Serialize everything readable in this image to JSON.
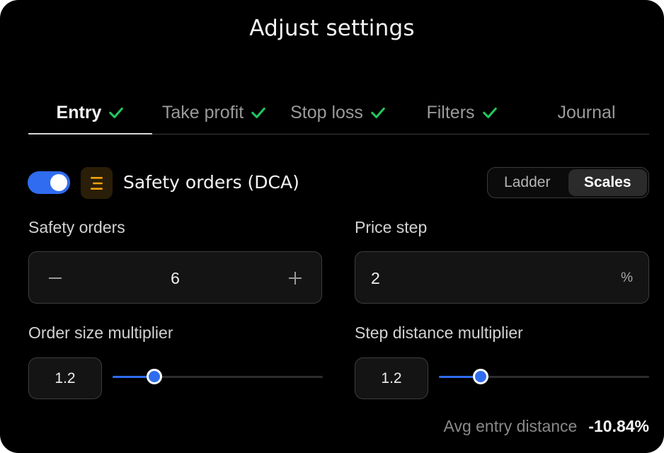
{
  "dialog": {
    "title": "Adjust settings"
  },
  "tabs": [
    {
      "label": "Entry",
      "checked": true,
      "active": true
    },
    {
      "label": "Take profit",
      "checked": true,
      "active": false
    },
    {
      "label": "Stop loss",
      "checked": true,
      "active": false
    },
    {
      "label": "Filters",
      "checked": true,
      "active": false
    },
    {
      "label": "Journal",
      "checked": false,
      "active": false
    }
  ],
  "section": {
    "title": "Safety orders (DCA)",
    "enabled": true,
    "icon": "list-lines-icon",
    "mode_options": [
      "Ladder",
      "Scales"
    ],
    "mode_selected": "Scales"
  },
  "fields": {
    "safety_orders": {
      "label": "Safety orders",
      "value": "6",
      "minus": "−",
      "plus": "+"
    },
    "price_step": {
      "label": "Price step",
      "value": "2",
      "unit": "%"
    },
    "order_size_multiplier": {
      "label": "Order size multiplier",
      "value": "1.2",
      "slider_fraction": 0.2
    },
    "step_distance_multiplier": {
      "label": "Step distance multiplier",
      "value": "1.2",
      "slider_fraction": 0.2
    }
  },
  "summary": {
    "label": "Avg entry distance",
    "value": "-10.84%"
  },
  "colors": {
    "accent": "#2f6cf0",
    "check": "#22c55e",
    "icon_amber": "#f5a20a",
    "background": "#000000"
  }
}
